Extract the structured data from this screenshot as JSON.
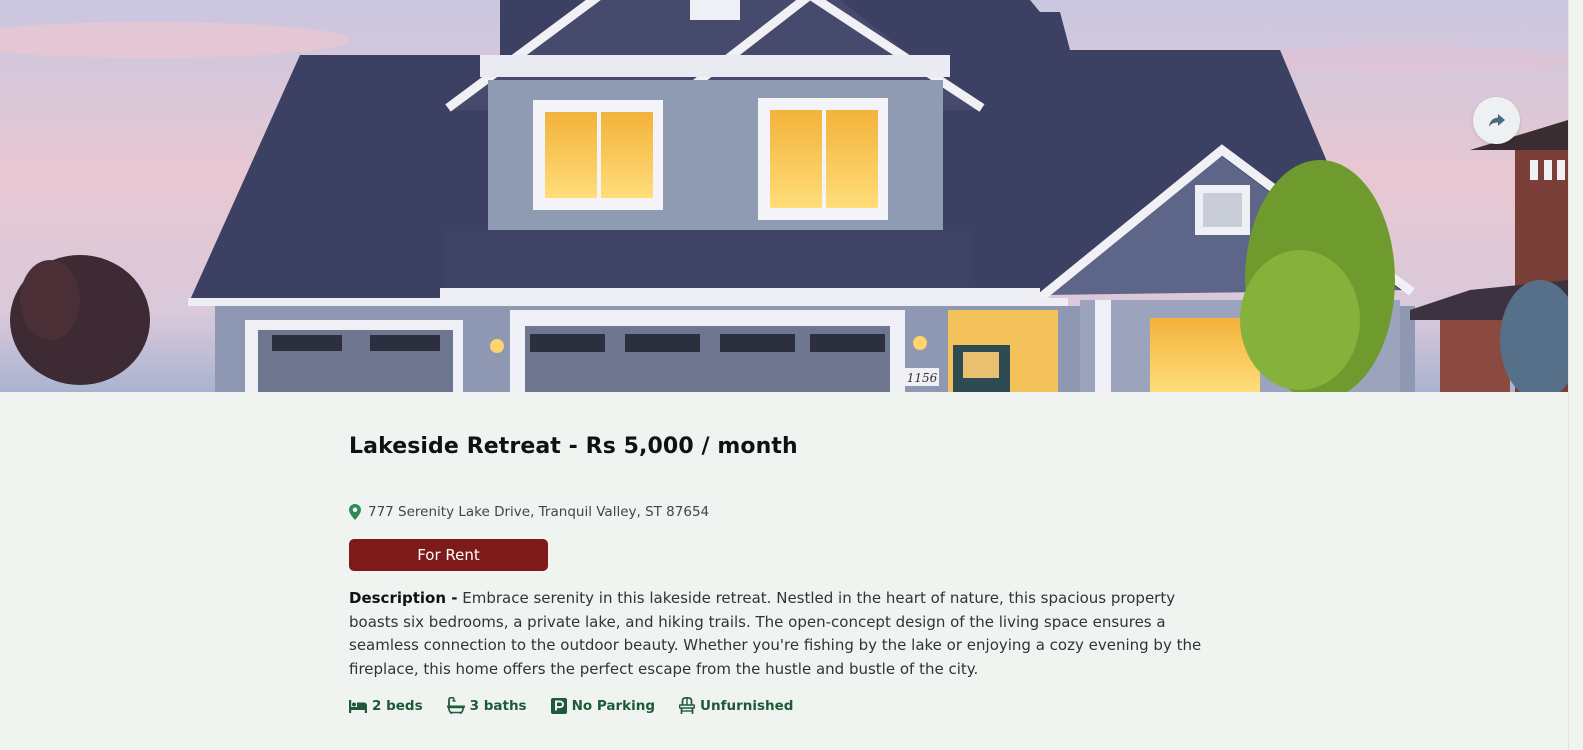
{
  "listing": {
    "title": "Lakeside Retreat - Rs 5,000 / month",
    "address": "777 Serenity Lake Drive, Tranquil Valley, ST 87654",
    "status": "For Rent",
    "description_label": "Description -",
    "description": "Embrace serenity in this lakeside retreat. Nestled in the heart of nature, this spacious property boasts six bedrooms, a private lake, and hiking trails. The open-concept design of the living space ensures a seamless connection to the outdoor beauty. Whether you're fishing by the lake or enjoying a cozy evening by the fireplace, this home offers the perfect escape from the hustle and bustle of the city.",
    "house_number": "1156"
  },
  "features": [
    {
      "icon": "bed-icon",
      "label": "2 beds"
    },
    {
      "icon": "bath-icon",
      "label": "3 baths"
    },
    {
      "icon": "parking-icon",
      "label": "No Parking"
    },
    {
      "icon": "chair-icon",
      "label": "Unfurnished"
    }
  ],
  "share_button": {
    "icon": "share-icon"
  },
  "colors": {
    "page_background": "#f0f4f1",
    "status_badge": "#7f1a1a",
    "feature_text": "#1e5a3a",
    "pin_icon": "#2e8b57"
  }
}
